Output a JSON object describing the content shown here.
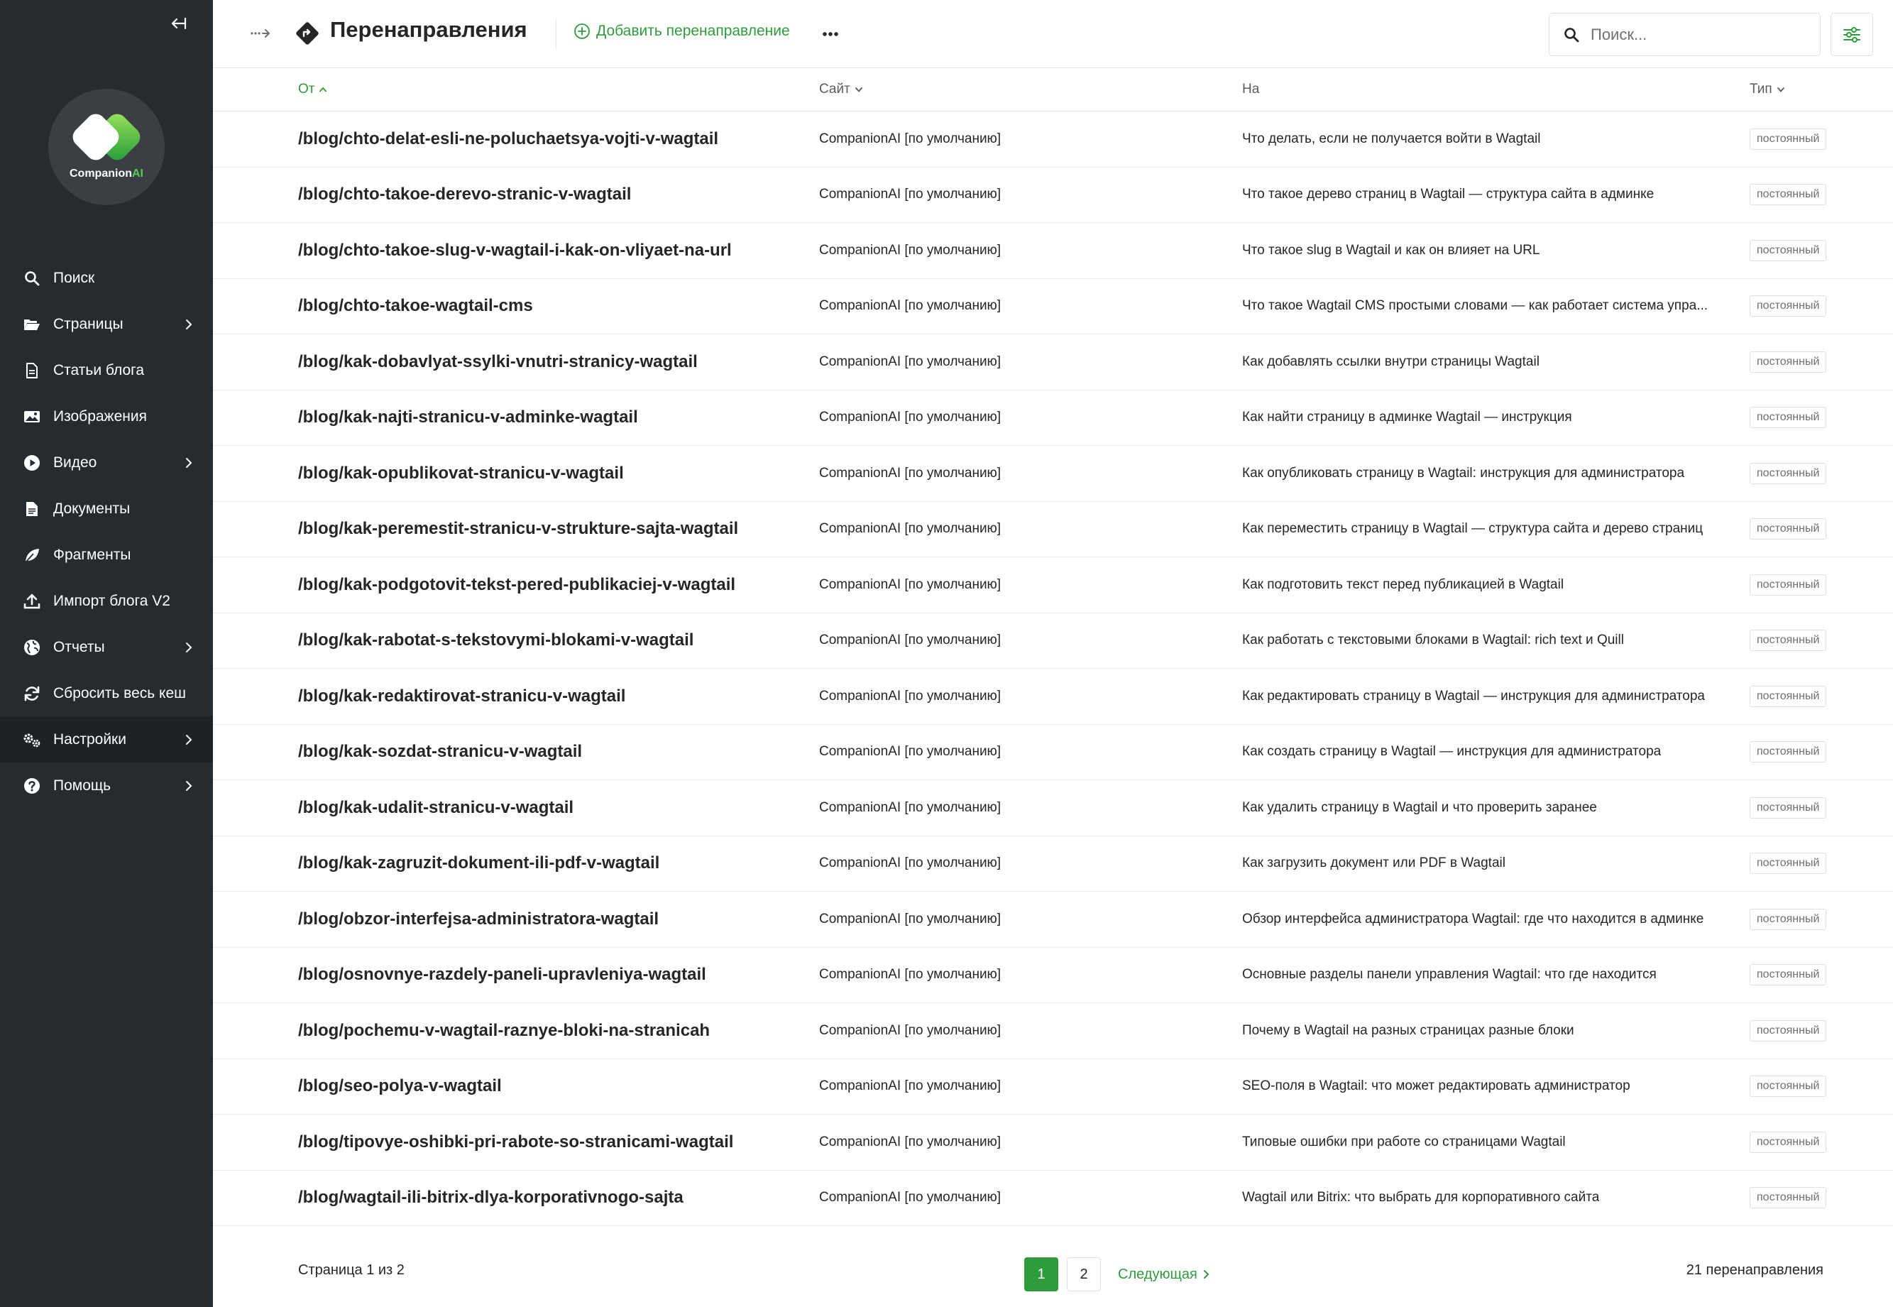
{
  "app": {
    "logo_name": "Companion",
    "logo_suffix": "AI"
  },
  "sidebar": {
    "items": [
      {
        "label": "Поиск",
        "icon": "search-icon",
        "has_submenu": false,
        "active": false
      },
      {
        "label": "Страницы",
        "icon": "folder-open-icon",
        "has_submenu": true,
        "active": false
      },
      {
        "label": "Статьи блога",
        "icon": "document-icon",
        "has_submenu": false,
        "active": false
      },
      {
        "label": "Изображения",
        "icon": "image-icon",
        "has_submenu": false,
        "active": false
      },
      {
        "label": "Видео",
        "icon": "play-circle-icon",
        "has_submenu": true,
        "active": false
      },
      {
        "label": "Документы",
        "icon": "doc-full-icon",
        "has_submenu": false,
        "active": false
      },
      {
        "label": "Фрагменты",
        "icon": "snippet-leaf-icon",
        "has_submenu": false,
        "active": false
      },
      {
        "label": "Импорт блога V2",
        "icon": "upload-icon",
        "has_submenu": false,
        "active": false
      },
      {
        "label": "Отчеты",
        "icon": "globe-icon",
        "has_submenu": true,
        "active": false
      },
      {
        "label": "Сбросить весь кеш",
        "icon": "refresh-icon",
        "has_submenu": false,
        "active": false
      },
      {
        "label": "Настройки",
        "icon": "cogs-icon",
        "has_submenu": true,
        "active": true
      },
      {
        "label": "Помощь",
        "icon": "help-icon",
        "has_submenu": true,
        "active": false
      }
    ]
  },
  "header": {
    "title": "Перенаправления",
    "add_label": "Добавить перенаправление",
    "search_placeholder": "Поиск..."
  },
  "table": {
    "columns": {
      "from": "От",
      "site": "Сайт",
      "to": "На",
      "type": "Тип"
    },
    "rows": [
      {
        "from": "/blog/chto-delat-esli-ne-poluchaetsya-vojti-v-wagtail",
        "site": "CompanionAI [по умолчанию]",
        "to": "Что делать, если не получается войти в Wagtail",
        "type": "постоянный"
      },
      {
        "from": "/blog/chto-takoe-derevo-stranic-v-wagtail",
        "site": "CompanionAI [по умолчанию]",
        "to": "Что такое дерево страниц в Wagtail — структура сайта в админке",
        "type": "постоянный"
      },
      {
        "from": "/blog/chto-takoe-slug-v-wagtail-i-kak-on-vliyaet-na-url",
        "site": "CompanionAI [по умолчанию]",
        "to": "Что такое slug в Wagtail и как он влияет на URL",
        "type": "постоянный"
      },
      {
        "from": "/blog/chto-takoe-wagtail-cms",
        "site": "CompanionAI [по умолчанию]",
        "to": "Что такое Wagtail CMS простыми словами — как работает система упра...",
        "type": "постоянный"
      },
      {
        "from": "/blog/kak-dobavlyat-ssylki-vnutri-stranicy-wagtail",
        "site": "CompanionAI [по умолчанию]",
        "to": "Как добавлять ссылки внутри страницы Wagtail",
        "type": "постоянный"
      },
      {
        "from": "/blog/kak-najti-stranicu-v-adminke-wagtail",
        "site": "CompanionAI [по умолчанию]",
        "to": "Как найти страницу в админке Wagtail — инструкция",
        "type": "постоянный"
      },
      {
        "from": "/blog/kak-opublikovat-stranicu-v-wagtail",
        "site": "CompanionAI [по умолчанию]",
        "to": "Как опубликовать страницу в Wagtail: инструкция для администратора",
        "type": "постоянный"
      },
      {
        "from": "/blog/kak-peremestit-stranicu-v-strukture-sajta-wagtail",
        "site": "CompanionAI [по умолчанию]",
        "to": "Как переместить страницу в Wagtail — структура сайта и дерево страниц",
        "type": "постоянный"
      },
      {
        "from": "/blog/kak-podgotovit-tekst-pered-publikaciej-v-wagtail",
        "site": "CompanionAI [по умолчанию]",
        "to": "Как подготовить текст перед публикацией в Wagtail",
        "type": "постоянный"
      },
      {
        "from": "/blog/kak-rabotat-s-tekstovymi-blokami-v-wagtail",
        "site": "CompanionAI [по умолчанию]",
        "to": "Как работать с текстовыми блоками в Wagtail: rich text и Quill",
        "type": "постоянный"
      },
      {
        "from": "/blog/kak-redaktirovat-stranicu-v-wagtail",
        "site": "CompanionAI [по умолчанию]",
        "to": "Как редактировать страницу в Wagtail — инструкция для администратора",
        "type": "постоянный"
      },
      {
        "from": "/blog/kak-sozdat-stranicu-v-wagtail",
        "site": "CompanionAI [по умолчанию]",
        "to": "Как создать страницу в Wagtail — инструкция для администратора",
        "type": "постоянный"
      },
      {
        "from": "/blog/kak-udalit-stranicu-v-wagtail",
        "site": "CompanionAI [по умолчанию]",
        "to": "Как удалить страницу в Wagtail и что проверить заранее",
        "type": "постоянный"
      },
      {
        "from": "/blog/kak-zagruzit-dokument-ili-pdf-v-wagtail",
        "site": "CompanionAI [по умолчанию]",
        "to": "Как загрузить документ или PDF в Wagtail",
        "type": "постоянный"
      },
      {
        "from": "/blog/obzor-interfejsa-administratora-wagtail",
        "site": "CompanionAI [по умолчанию]",
        "to": "Обзор интерфейса администратора Wagtail: где что находится в админке",
        "type": "постоянный"
      },
      {
        "from": "/blog/osnovnye-razdely-paneli-upravleniya-wagtail",
        "site": "CompanionAI [по умолчанию]",
        "to": "Основные разделы панели управления Wagtail: что где находится",
        "type": "постоянный"
      },
      {
        "from": "/blog/pochemu-v-wagtail-raznye-bloki-na-stranicah",
        "site": "CompanionAI [по умолчанию]",
        "to": "Почему в Wagtail на разных страницах разные блоки",
        "type": "постоянный"
      },
      {
        "from": "/blog/seo-polya-v-wagtail",
        "site": "CompanionAI [по умолчанию]",
        "to": "SEO-поля в Wagtail: что может редактировать администратор",
        "type": "постоянный"
      },
      {
        "from": "/blog/tipovye-oshibki-pri-rabote-so-stranicami-wagtail",
        "site": "CompanionAI [по умолчанию]",
        "to": "Типовые ошибки при работе со страницами Wagtail",
        "type": "постоянный"
      },
      {
        "from": "/blog/wagtail-ili-bitrix-dlya-korporativnogo-sajta",
        "site": "CompanionAI [по умолчанию]",
        "to": "Wagtail или Bitrix: что выбрать для корпоративного сайта",
        "type": "постоянный"
      }
    ]
  },
  "footer": {
    "page_info": "Страница 1 из 2",
    "pages": [
      "1",
      "2"
    ],
    "current_page": "1",
    "next_label": "Следующая",
    "total": "21 перенаправления"
  },
  "colors": {
    "sidebar_bg": "#262b2f",
    "accent_green": "#2e9c3a",
    "text": "#262626"
  }
}
